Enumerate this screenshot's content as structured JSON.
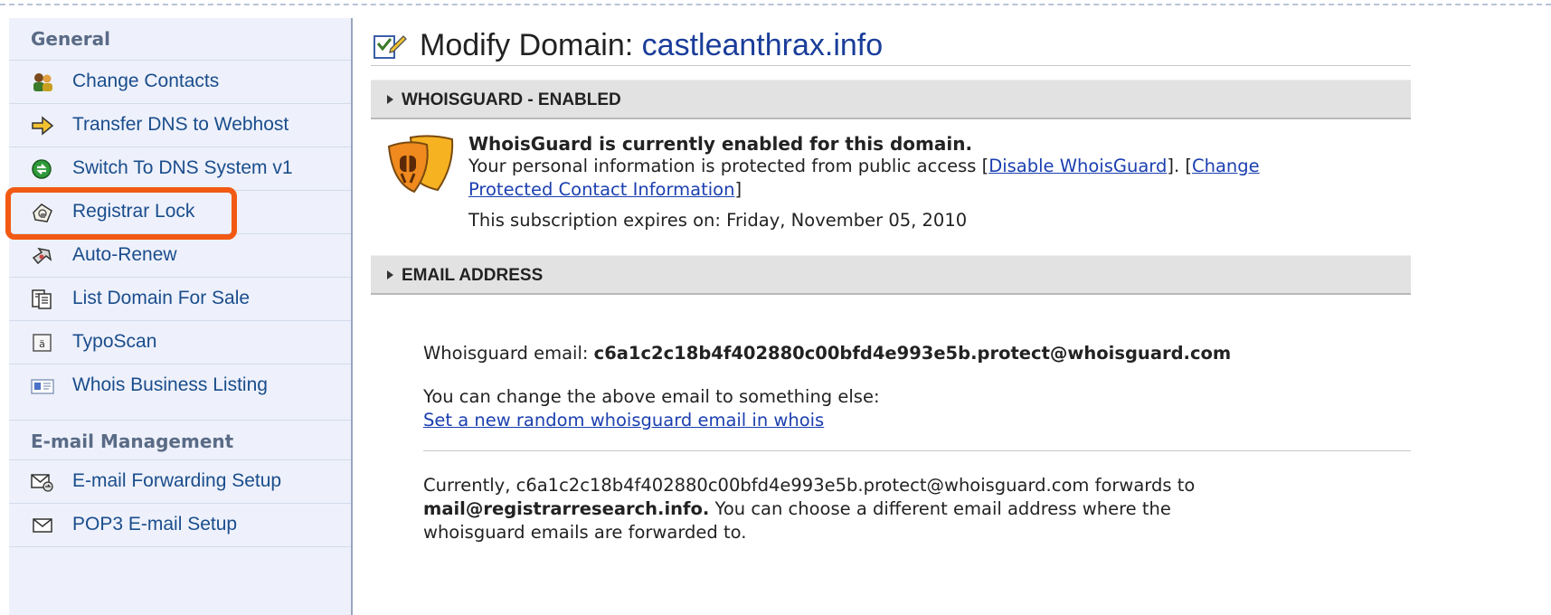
{
  "sidebar": {
    "general_heading": "General",
    "general_items": [
      {
        "label": "Change Contacts",
        "icon": "contacts-icon"
      },
      {
        "label": "Transfer DNS to Webhost",
        "icon": "arrow-right-icon"
      },
      {
        "label": "Switch To DNS System v1",
        "icon": "switch-icon"
      },
      {
        "label": "Registrar Lock",
        "icon": "lock-icon"
      },
      {
        "label": "Auto-Renew",
        "icon": "auto-renew-icon"
      },
      {
        "label": "List Domain For Sale",
        "icon": "clipboard-icon"
      },
      {
        "label": "TypoScan",
        "icon": "typoscan-icon"
      },
      {
        "label": "Whois Business Listing",
        "icon": "business-card-icon"
      }
    ],
    "email_heading": "E-mail Management",
    "email_items": [
      {
        "label": "E-mail Forwarding Setup",
        "icon": "email-forward-icon"
      },
      {
        "label": "POP3 E-mail Setup",
        "icon": "envelope-icon"
      }
    ]
  },
  "main": {
    "title_prefix": "Modify Domain:",
    "domain": "castleanthrax.info",
    "whoisguard": {
      "header": "WHOISGUARD - ENABLED",
      "status_bold": "WhoisGuard is currently enabled for this domain.",
      "protected_text": "Your personal information is protected from public access [",
      "disable_link": "Disable WhoisGuard",
      "between_text": "]. [",
      "change_link_1": "Change",
      "change_link_2": "Protected Contact Information",
      "close_bracket": "]",
      "expires_text": "This subscription expires on: Friday, November 05, 2010"
    },
    "email": {
      "header": "EMAIL ADDRESS",
      "wg_email_label": "Whoisguard email: ",
      "wg_email_value": "c6a1c2c18b4f402880c00bfd4e993e5b.protect@whoisguard.com",
      "change_text": "You can change the above email to something else:",
      "random_link": "Set a new random whoisguard email in whois",
      "forward_line1": "Currently, c6a1c2c18b4f402880c00bfd4e993e5b.protect@whoisguard.com forwards to",
      "forward_bold": "mail@registrarresearch.info.",
      "forward_line2_rest": " You can choose a different email address where the",
      "forward_line3": "whoisguard emails are forwarded to."
    }
  },
  "colors": {
    "sidebar_bg": "#eef1fb",
    "nav_text": "#1a4d8c",
    "link": "#1b3fb0",
    "highlight": "#f25a14",
    "section_bar": "#e2e2e2"
  }
}
